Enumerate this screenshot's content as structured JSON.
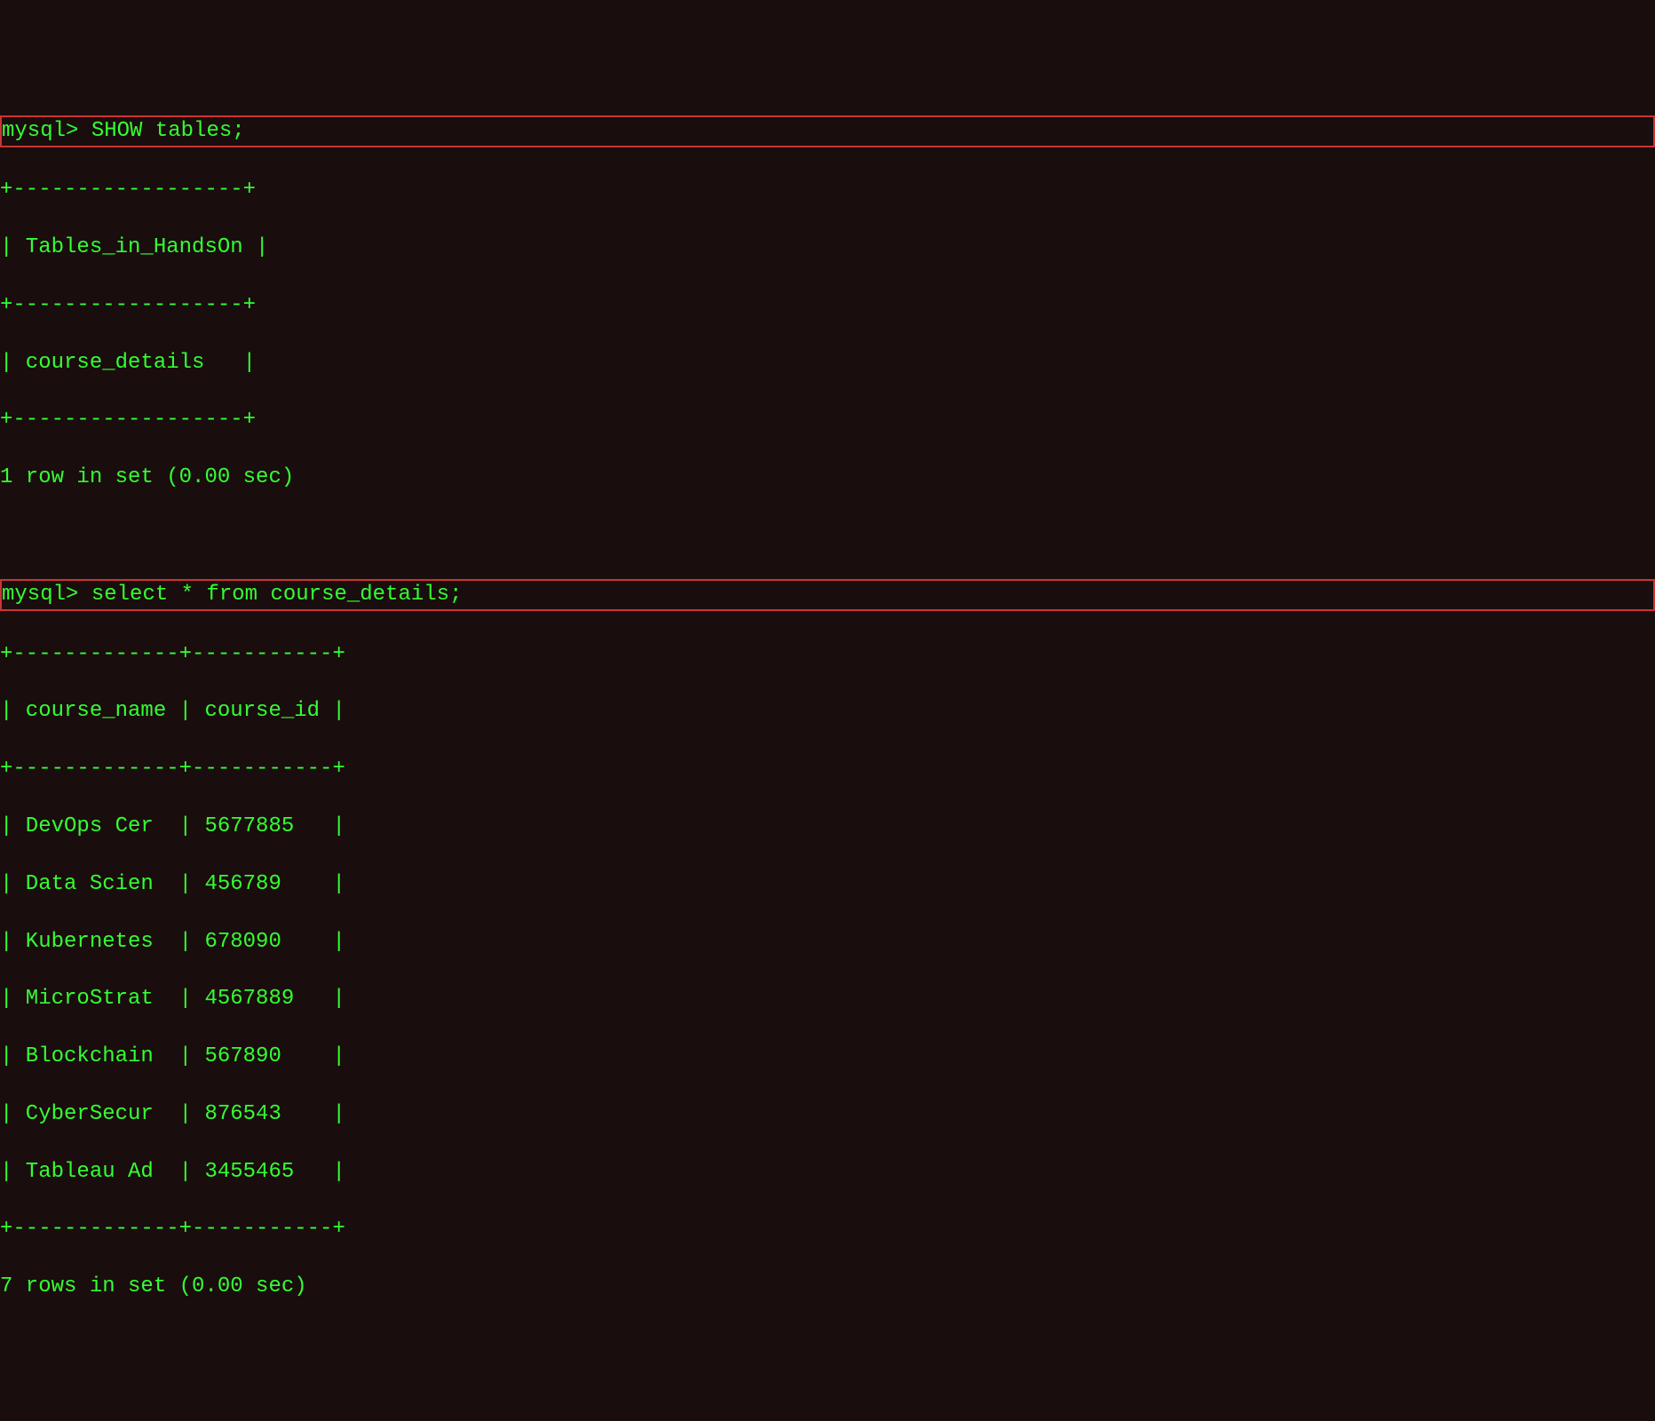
{
  "prompt": "mysql>",
  "query1": {
    "command": "SHOW tables;",
    "table_border": "+------------------+",
    "header": "| Tables_in_HandsOn |",
    "rows": [
      "| course_details   |"
    ],
    "footer": "1 row in set (0.00 sec)"
  },
  "query2": {
    "command": "select * from course_details;",
    "table_border": "+-------------+-----------+",
    "header": "| course_name | course_id |",
    "rows": [
      "| DevOps Cer  | 5677885   |",
      "| Data Scien  | 456789    |",
      "| Kubernetes  | 678090    |",
      "| MicroStrat  | 4567889   |",
      "| Blockchain  | 567890    |",
      "| CyberSecur  | 876543    |",
      "| Tableau Ad  | 3455465   |"
    ],
    "footer": "7 rows in set (0.00 sec)"
  }
}
